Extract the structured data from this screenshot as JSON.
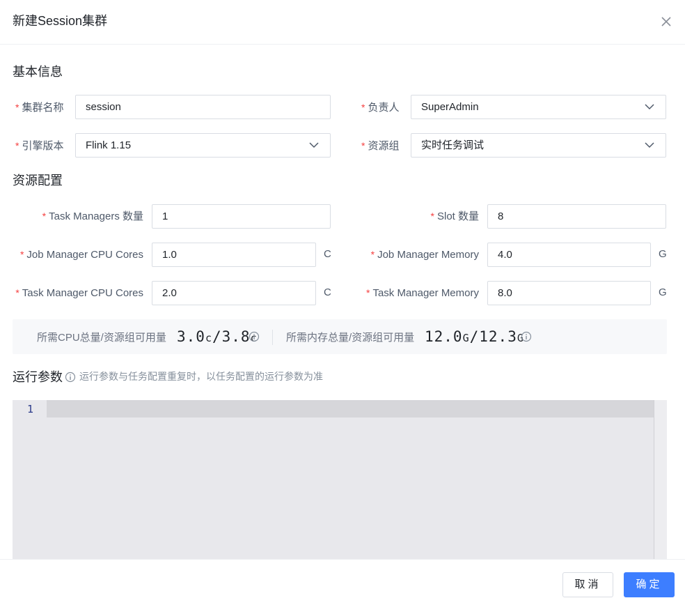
{
  "dialog": {
    "title": "新建Session集群",
    "close_icon": "close-icon"
  },
  "basic": {
    "title": "基本信息",
    "cluster_name": {
      "label": "集群名称",
      "value": "session"
    },
    "owner": {
      "label": "负责人",
      "value": "SuperAdmin"
    },
    "engine": {
      "label": "引擎版本",
      "value": "Flink 1.15"
    },
    "resource_group": {
      "label": "资源组",
      "value": "实时任务调试"
    }
  },
  "resources": {
    "title": "资源配置",
    "task_managers": {
      "label": "Task Managers 数量",
      "value": "1"
    },
    "slot": {
      "label": "Slot 数量",
      "value": "8"
    },
    "jm_cpu": {
      "label": "Job Manager CPU Cores",
      "value": "1.0",
      "unit": "C"
    },
    "jm_mem": {
      "label": "Job Manager Memory",
      "value": "4.0",
      "unit": "G"
    },
    "tm_cpu": {
      "label": "Task Manager CPU Cores",
      "value": "2.0",
      "unit": "C"
    },
    "tm_mem": {
      "label": "Task Manager Memory",
      "value": "8.0",
      "unit": "G"
    }
  },
  "summary": {
    "cpu_label": "所需CPU总量/资源组可用量",
    "cpu_used": "3.0",
    "cpu_unit1": "c",
    "sep": "/",
    "cpu_avail": "3.8",
    "cpu_unit2": "c",
    "mem_label": "所需内存总量/资源组可用量",
    "mem_used": "12.0",
    "mem_unit1": "G",
    "mem_avail": "12.3",
    "mem_unit2": "G"
  },
  "run_params": {
    "title": "运行参数",
    "hint": "运行参数与任务配置重复时，以任务配置的运行参数为准",
    "line_number": "1"
  },
  "footer": {
    "cancel": "取消",
    "confirm": "确定"
  },
  "colors": {
    "primary": "#3d7eff",
    "required": "#f53f3f",
    "editor_bg": "#e8e8ec"
  }
}
